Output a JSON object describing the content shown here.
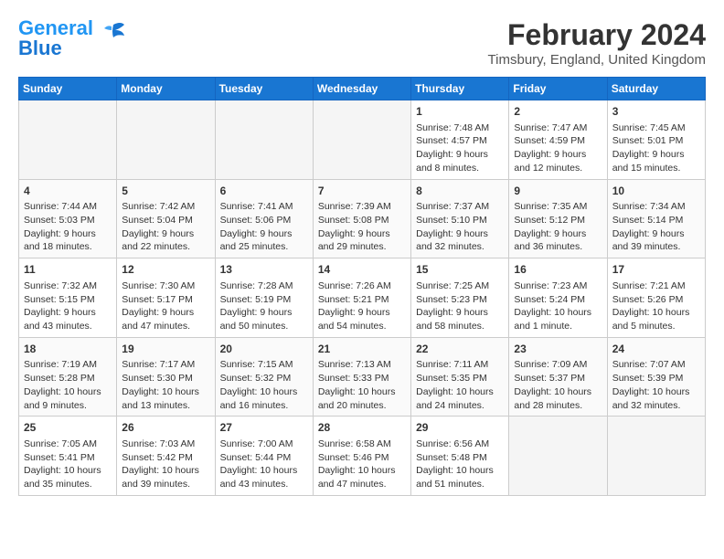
{
  "header": {
    "logo_line1": "General",
    "logo_line2": "Blue",
    "month_year": "February 2024",
    "location": "Timsbury, England, United Kingdom"
  },
  "weekdays": [
    "Sunday",
    "Monday",
    "Tuesday",
    "Wednesday",
    "Thursday",
    "Friday",
    "Saturday"
  ],
  "weeks": [
    [
      {
        "day": "",
        "content": ""
      },
      {
        "day": "",
        "content": ""
      },
      {
        "day": "",
        "content": ""
      },
      {
        "day": "",
        "content": ""
      },
      {
        "day": "1",
        "content": "Sunrise: 7:48 AM\nSunset: 4:57 PM\nDaylight: 9 hours\nand 8 minutes."
      },
      {
        "day": "2",
        "content": "Sunrise: 7:47 AM\nSunset: 4:59 PM\nDaylight: 9 hours\nand 12 minutes."
      },
      {
        "day": "3",
        "content": "Sunrise: 7:45 AM\nSunset: 5:01 PM\nDaylight: 9 hours\nand 15 minutes."
      }
    ],
    [
      {
        "day": "4",
        "content": "Sunrise: 7:44 AM\nSunset: 5:03 PM\nDaylight: 9 hours\nand 18 minutes."
      },
      {
        "day": "5",
        "content": "Sunrise: 7:42 AM\nSunset: 5:04 PM\nDaylight: 9 hours\nand 22 minutes."
      },
      {
        "day": "6",
        "content": "Sunrise: 7:41 AM\nSunset: 5:06 PM\nDaylight: 9 hours\nand 25 minutes."
      },
      {
        "day": "7",
        "content": "Sunrise: 7:39 AM\nSunset: 5:08 PM\nDaylight: 9 hours\nand 29 minutes."
      },
      {
        "day": "8",
        "content": "Sunrise: 7:37 AM\nSunset: 5:10 PM\nDaylight: 9 hours\nand 32 minutes."
      },
      {
        "day": "9",
        "content": "Sunrise: 7:35 AM\nSunset: 5:12 PM\nDaylight: 9 hours\nand 36 minutes."
      },
      {
        "day": "10",
        "content": "Sunrise: 7:34 AM\nSunset: 5:14 PM\nDaylight: 9 hours\nand 39 minutes."
      }
    ],
    [
      {
        "day": "11",
        "content": "Sunrise: 7:32 AM\nSunset: 5:15 PM\nDaylight: 9 hours\nand 43 minutes."
      },
      {
        "day": "12",
        "content": "Sunrise: 7:30 AM\nSunset: 5:17 PM\nDaylight: 9 hours\nand 47 minutes."
      },
      {
        "day": "13",
        "content": "Sunrise: 7:28 AM\nSunset: 5:19 PM\nDaylight: 9 hours\nand 50 minutes."
      },
      {
        "day": "14",
        "content": "Sunrise: 7:26 AM\nSunset: 5:21 PM\nDaylight: 9 hours\nand 54 minutes."
      },
      {
        "day": "15",
        "content": "Sunrise: 7:25 AM\nSunset: 5:23 PM\nDaylight: 9 hours\nand 58 minutes."
      },
      {
        "day": "16",
        "content": "Sunrise: 7:23 AM\nSunset: 5:24 PM\nDaylight: 10 hours\nand 1 minute."
      },
      {
        "day": "17",
        "content": "Sunrise: 7:21 AM\nSunset: 5:26 PM\nDaylight: 10 hours\nand 5 minutes."
      }
    ],
    [
      {
        "day": "18",
        "content": "Sunrise: 7:19 AM\nSunset: 5:28 PM\nDaylight: 10 hours\nand 9 minutes."
      },
      {
        "day": "19",
        "content": "Sunrise: 7:17 AM\nSunset: 5:30 PM\nDaylight: 10 hours\nand 13 minutes."
      },
      {
        "day": "20",
        "content": "Sunrise: 7:15 AM\nSunset: 5:32 PM\nDaylight: 10 hours\nand 16 minutes."
      },
      {
        "day": "21",
        "content": "Sunrise: 7:13 AM\nSunset: 5:33 PM\nDaylight: 10 hours\nand 20 minutes."
      },
      {
        "day": "22",
        "content": "Sunrise: 7:11 AM\nSunset: 5:35 PM\nDaylight: 10 hours\nand 24 minutes."
      },
      {
        "day": "23",
        "content": "Sunrise: 7:09 AM\nSunset: 5:37 PM\nDaylight: 10 hours\nand 28 minutes."
      },
      {
        "day": "24",
        "content": "Sunrise: 7:07 AM\nSunset: 5:39 PM\nDaylight: 10 hours\nand 32 minutes."
      }
    ],
    [
      {
        "day": "25",
        "content": "Sunrise: 7:05 AM\nSunset: 5:41 PM\nDaylight: 10 hours\nand 35 minutes."
      },
      {
        "day": "26",
        "content": "Sunrise: 7:03 AM\nSunset: 5:42 PM\nDaylight: 10 hours\nand 39 minutes."
      },
      {
        "day": "27",
        "content": "Sunrise: 7:00 AM\nSunset: 5:44 PM\nDaylight: 10 hours\nand 43 minutes."
      },
      {
        "day": "28",
        "content": "Sunrise: 6:58 AM\nSunset: 5:46 PM\nDaylight: 10 hours\nand 47 minutes."
      },
      {
        "day": "29",
        "content": "Sunrise: 6:56 AM\nSunset: 5:48 PM\nDaylight: 10 hours\nand 51 minutes."
      },
      {
        "day": "",
        "content": ""
      },
      {
        "day": "",
        "content": ""
      }
    ]
  ]
}
